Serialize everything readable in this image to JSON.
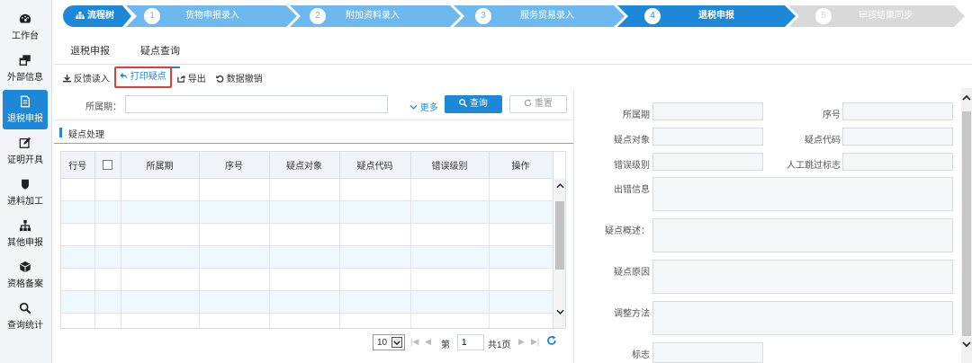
{
  "sidebar": {
    "items": [
      {
        "label": "工作台",
        "icon": "dashboard-icon"
      },
      {
        "label": "外部信息",
        "icon": "window-icon"
      },
      {
        "label": "退税申报",
        "icon": "document-icon"
      },
      {
        "label": "证明开具",
        "icon": "edit-icon"
      },
      {
        "label": "进料加工",
        "icon": "shield-icon"
      },
      {
        "label": "其他申报",
        "icon": "hierarchy-icon"
      },
      {
        "label": "资格备案",
        "icon": "cube-icon"
      },
      {
        "label": "查询统计",
        "icon": "search-icon"
      }
    ]
  },
  "stepper": {
    "root_label": "流程树",
    "steps": [
      {
        "num": "1",
        "label": "货物申报录入"
      },
      {
        "num": "2",
        "label": "附加资料录入"
      },
      {
        "num": "3",
        "label": "服务贸易录入"
      },
      {
        "num": "4",
        "label": "退税申报"
      },
      {
        "num": "5",
        "label": "审核结果同步"
      }
    ]
  },
  "tabs": [
    "退税申报",
    "疑点查询"
  ],
  "toolbar": {
    "feedback": "反馈读入",
    "print": "打印疑点",
    "export": "导出",
    "revoke": "数据撤销"
  },
  "search": {
    "period_label": "所属期：",
    "period_value": "",
    "more": "更多",
    "query": "查询",
    "reset": "重置"
  },
  "section_title": "疑点处理",
  "table": {
    "headers": [
      "行号",
      "",
      "所属期",
      "序号",
      "疑点对象",
      "疑点代码",
      "错误级别",
      "操作"
    ],
    "row_count": 7
  },
  "pager": {
    "page_size": "10",
    "page_prefix": "第",
    "page_value": "1",
    "total": "共1页"
  },
  "form": {
    "period": "所属期",
    "seq": "序号",
    "object": "疑点对象",
    "code": "疑点代码",
    "level": "错误级别",
    "manual_skip": "人工跳过标志",
    "error_info": "出错信息",
    "summary": "疑点概述：",
    "reason": "疑点原因",
    "adjust": "调整方法",
    "flag": "标志"
  },
  "colors": {
    "primary": "#1e88d8",
    "step_done": "#6cb8ef",
    "step_active": "#1e88d8",
    "step_pending": "#d9d9d9",
    "highlight_box": "#e53b3b"
  }
}
